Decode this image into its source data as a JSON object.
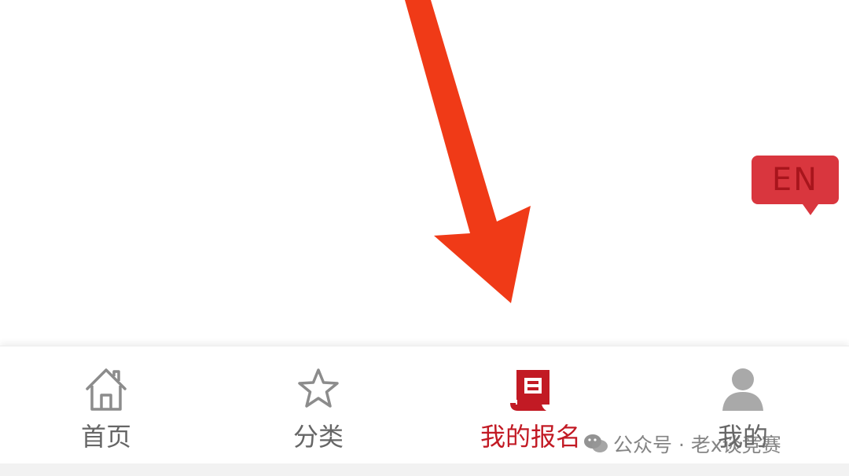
{
  "language_toggle": {
    "label": "EN",
    "color": "#d9363e"
  },
  "annotation": {
    "arrow_color": "#f03a17"
  },
  "tab_bar": {
    "active_color": "#c21a24",
    "inactive_color": "#8c8c8c",
    "tabs": [
      {
        "label": "首页",
        "icon": "home-icon",
        "active": false
      },
      {
        "label": "分类",
        "icon": "star-icon",
        "active": false
      },
      {
        "label": "我的报名",
        "icon": "registration-document-icon",
        "active": true
      },
      {
        "label": "我的",
        "icon": "person-icon",
        "active": false
      }
    ]
  },
  "watermark": {
    "text": "公众号 · 老x谈竞赛"
  }
}
